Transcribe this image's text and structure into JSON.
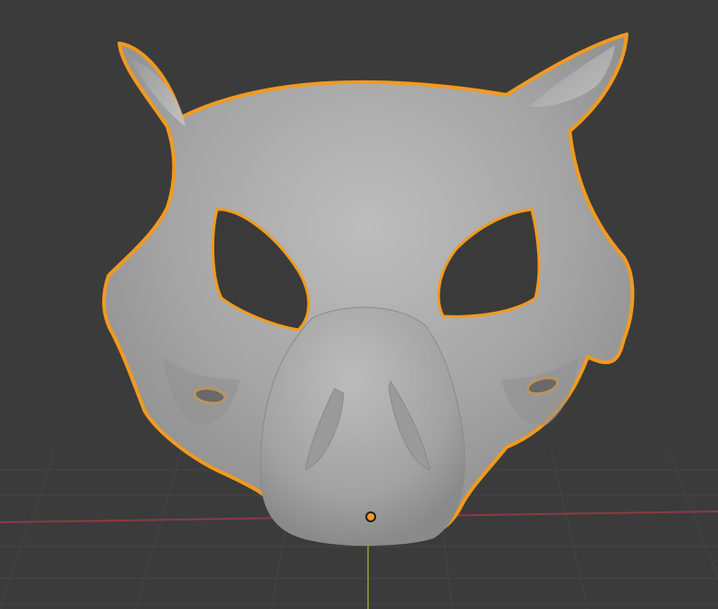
{
  "viewport": {
    "background_color": "#3b3b3b",
    "grid_color": "#454545",
    "x_axis_color": "#8a3b45",
    "y_axis_color": "#6f8f2a"
  },
  "object": {
    "name_icon": "mask-mesh",
    "selected": true,
    "selection_outline_color": "#f29a1f",
    "surface_color": "#a9a9a9",
    "origin_marker_color": "#f29a1f"
  }
}
